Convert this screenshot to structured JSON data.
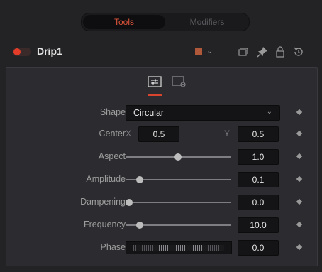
{
  "tabs": {
    "active": "Tools",
    "inactive": "Modifiers"
  },
  "node": {
    "name": "Drip1",
    "enabled": true,
    "swatch_color": "#b0583a"
  },
  "header_icons": [
    "swatch-chevron-icon",
    "stack-icon",
    "pin-icon",
    "lock-icon",
    "reset-icon"
  ],
  "panel_tabs": [
    "controls-tab-icon",
    "settings-tab-icon"
  ],
  "accent": "#d9442f",
  "params": {
    "shape": {
      "label": "Shape",
      "value": "Circular"
    },
    "center": {
      "label": "Center",
      "x_label": "X",
      "x": "0.5",
      "y_label": "Y",
      "y": "0.5"
    },
    "aspect": {
      "label": "Aspect",
      "value": "1.0",
      "slider_fraction": 0.5
    },
    "amplitude": {
      "label": "Amplitude",
      "value": "0.1",
      "slider_fraction": 0.1
    },
    "dampening": {
      "label": "Dampening",
      "value": "0.0",
      "slider_fraction": 0.0
    },
    "frequency": {
      "label": "Frequency",
      "value": "10.0",
      "slider_fraction": 0.1
    },
    "phase": {
      "label": "Phase",
      "value": "0.0"
    }
  }
}
